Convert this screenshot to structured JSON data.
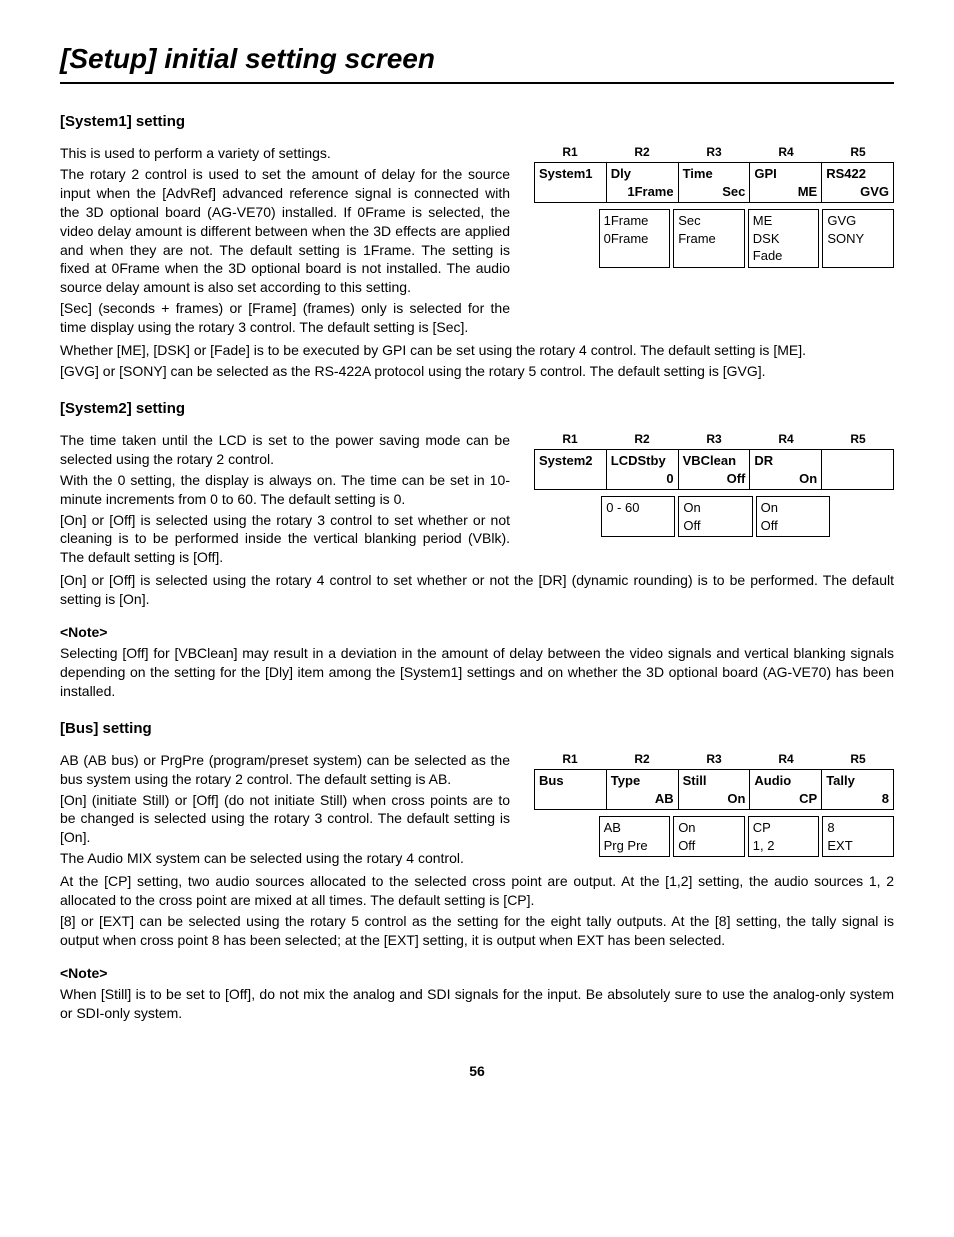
{
  "page_title": "[Setup] initial setting screen",
  "page_number": "56",
  "r_labels": [
    "R1",
    "R2",
    "R3",
    "R4",
    "R5"
  ],
  "system1": {
    "title": "[System1] setting",
    "intro": "This is used to perform a variety of settings.",
    "p1": "The rotary 2 control is used to set the amount of delay for the source input when the [AdvRef] advanced reference signal is connected with the 3D optional board (AG-VE70) installed.  If 0Frame is selected, the video delay amount is different between when the 3D effects are applied and when they are not.  The default setting is 1Frame.  The setting is fixed at 0Frame when the 3D optional board is not installed.  The audio source delay amount is also set according to this setting.",
    "p2": "[Sec] (seconds + frames) or [Frame] (frames) only is selected for the time display using the rotary 3 control.  The default setting is [Sec].",
    "p3": "Whether [ME], [DSK] or [Fade] is to be executed by GPI can be set using the rotary 4 control.  The default setting is [ME].",
    "p4": "[GVG] or [SONY] can be selected as the RS-422A protocol using the rotary 5 control.  The default setting is [GVG].",
    "row": {
      "c1": {
        "l1": "System1",
        "l2": ""
      },
      "c2": {
        "l1": "Dly",
        "l2": "1Frame"
      },
      "c3": {
        "l1": "Time",
        "l2": "Sec"
      },
      "c4": {
        "l1": "GPI",
        "l2": "ME"
      },
      "c5": {
        "l1": "RS422",
        "l2": "GVG"
      }
    },
    "opts": {
      "o2": [
        "1Frame",
        "0Frame"
      ],
      "o3": [
        "Sec",
        "Frame"
      ],
      "o4": [
        "ME",
        "DSK",
        "Fade"
      ],
      "o5": [
        "GVG",
        "SONY"
      ]
    }
  },
  "system2": {
    "title": "[System2] setting",
    "p1": "The time taken until the LCD is set to the power saving mode can be selected using the rotary 2 control.",
    "p2": "With the 0 setting, the display is always on.  The time can be set in 10-minute increments from 0 to 60.  The default setting is 0.",
    "p3": "[On] or [Off] is selected using the rotary 3 control to set whether or not cleaning is to be performed inside the vertical blanking period (VBlk).  The default setting is [Off].",
    "p4": "[On] or [Off] is selected using the rotary 4 control to set whether or not the [DR] (dynamic rounding) is to be performed.  The default setting is [On].",
    "note_label": "<Note>",
    "note": "Selecting [Off] for [VBClean] may result in a deviation in the amount of delay between the video signals and vertical blanking signals depending on the setting for the [Dly] item among the [System1] settings and on whether the 3D optional board (AG-VE70) has been installed.",
    "row": {
      "c1": {
        "l1": "System2",
        "l2": ""
      },
      "c2": {
        "l1": "LCDStby",
        "l2": "0"
      },
      "c3": {
        "l1": "VBClean",
        "l2": "Off"
      },
      "c4": {
        "l1": "DR",
        "l2": "On"
      },
      "c5": {
        "l1": "",
        "l2": ""
      }
    },
    "opts": {
      "o2": [
        "0 - 60"
      ],
      "o3": [
        "On",
        "Off"
      ],
      "o4": [
        "On",
        "Off"
      ]
    }
  },
  "bus": {
    "title": "[Bus] setting",
    "p1": "AB (AB bus) or PrgPre (program/preset system) can be selected as the bus system using the rotary 2 control.  The default setting is AB.",
    "p2": "[On] (initiate Still) or [Off] (do not initiate Still) when cross points are to be changed is selected using the rotary 3 control.  The default setting is [On].",
    "p3": "The Audio MIX system can be selected using the rotary 4 control.",
    "p4": "At the [CP] setting, two audio sources allocated to the selected cross point are output. At the [1,2] setting, the audio sources 1, 2 allocated to the cross point are mixed at all times.  The default setting is [CP].",
    "p5": "[8] or [EXT] can be selected using the rotary 5 control as the setting for the eight tally outputs. At the [8] setting, the tally signal is output when cross point 8 has been selected; at the [EXT] setting, it is output when EXT has been selected.",
    "note_label": "<Note>",
    "note": "When [Still] is to be set to [Off], do not mix the analog and SDI signals for the input. Be absolutely sure to use the analog-only system or SDI-only system.",
    "row": {
      "c1": {
        "l1": "Bus",
        "l2": ""
      },
      "c2": {
        "l1": "Type",
        "l2": "AB"
      },
      "c3": {
        "l1": "Still",
        "l2": "On"
      },
      "c4": {
        "l1": "Audio",
        "l2": "CP"
      },
      "c5": {
        "l1": "Tally",
        "l2": "8"
      }
    },
    "opts": {
      "o2": [
        "AB",
        "Prg Pre"
      ],
      "o3": [
        "On",
        "Off"
      ],
      "o4": [
        "CP",
        "1, 2"
      ],
      "o5": [
        "8",
        "EXT"
      ]
    }
  }
}
